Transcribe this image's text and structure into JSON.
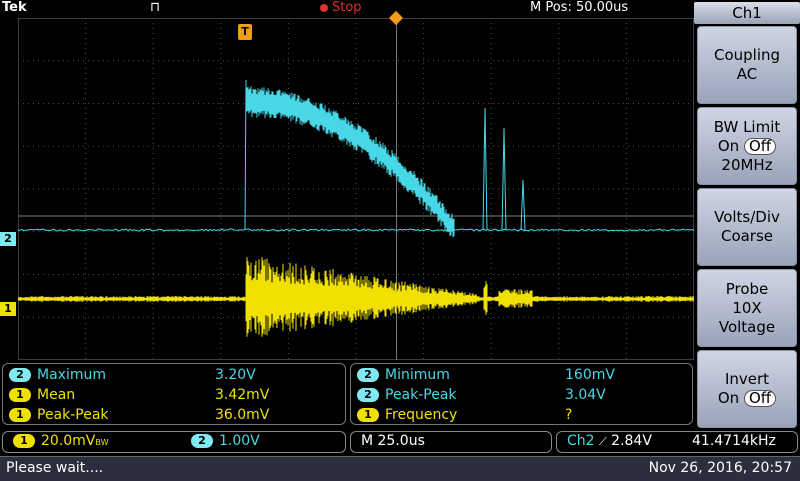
{
  "topbar": {
    "brand": "Tek",
    "acq_mode_symbol": "⊓",
    "run_state": "Stop",
    "horizontal_position": "M Pos: 50.00us",
    "trigger_marker": "T"
  },
  "channel_markers": {
    "ch2": "2",
    "ch1": "1"
  },
  "side_menu": {
    "title": "Ch1",
    "buttons": [
      {
        "line1": "Coupling",
        "line2": "AC"
      },
      {
        "line1": "BW Limit",
        "on": "On",
        "off": "Off",
        "line3": "20MHz"
      },
      {
        "line1": "Volts/Div",
        "line2": "Coarse"
      },
      {
        "line1": "Probe",
        "line2": "10X",
        "line3": "Voltage"
      },
      {
        "line1": "Invert",
        "on": "On",
        "off": "Off"
      }
    ]
  },
  "measurements_left": [
    {
      "ch": "2",
      "name": "Maximum",
      "value": "3.20V"
    },
    {
      "ch": "1",
      "name": "Mean",
      "value": "3.42mV"
    },
    {
      "ch": "1",
      "name": "Peak-Peak",
      "value": "36.0mV"
    }
  ],
  "measurements_right": [
    {
      "ch": "2",
      "name": "Minimum",
      "value": "160mV"
    },
    {
      "ch": "2",
      "name": "Peak-Peak",
      "value": "3.04V"
    },
    {
      "ch": "1",
      "name": "Frequency",
      "value": "?"
    }
  ],
  "info": {
    "ch1_badge": "1",
    "ch1_scale": "20.0mV",
    "ch1_bw_mark": "BW",
    "ch2_badge": "2",
    "ch2_scale": "1.00V",
    "timebase": "M 25.0us",
    "trigger_source": "Ch2",
    "trigger_slope": "⟋",
    "trigger_level": "2.84V",
    "trigger_frequency": "41.4714kHz"
  },
  "status": {
    "message": "Please wait....",
    "datetime": "Nov 26, 2016, 20:57"
  },
  "colors": {
    "ch1": "#f0e000",
    "ch2": "#48d7e6",
    "grid": "#5a6a5a"
  }
}
